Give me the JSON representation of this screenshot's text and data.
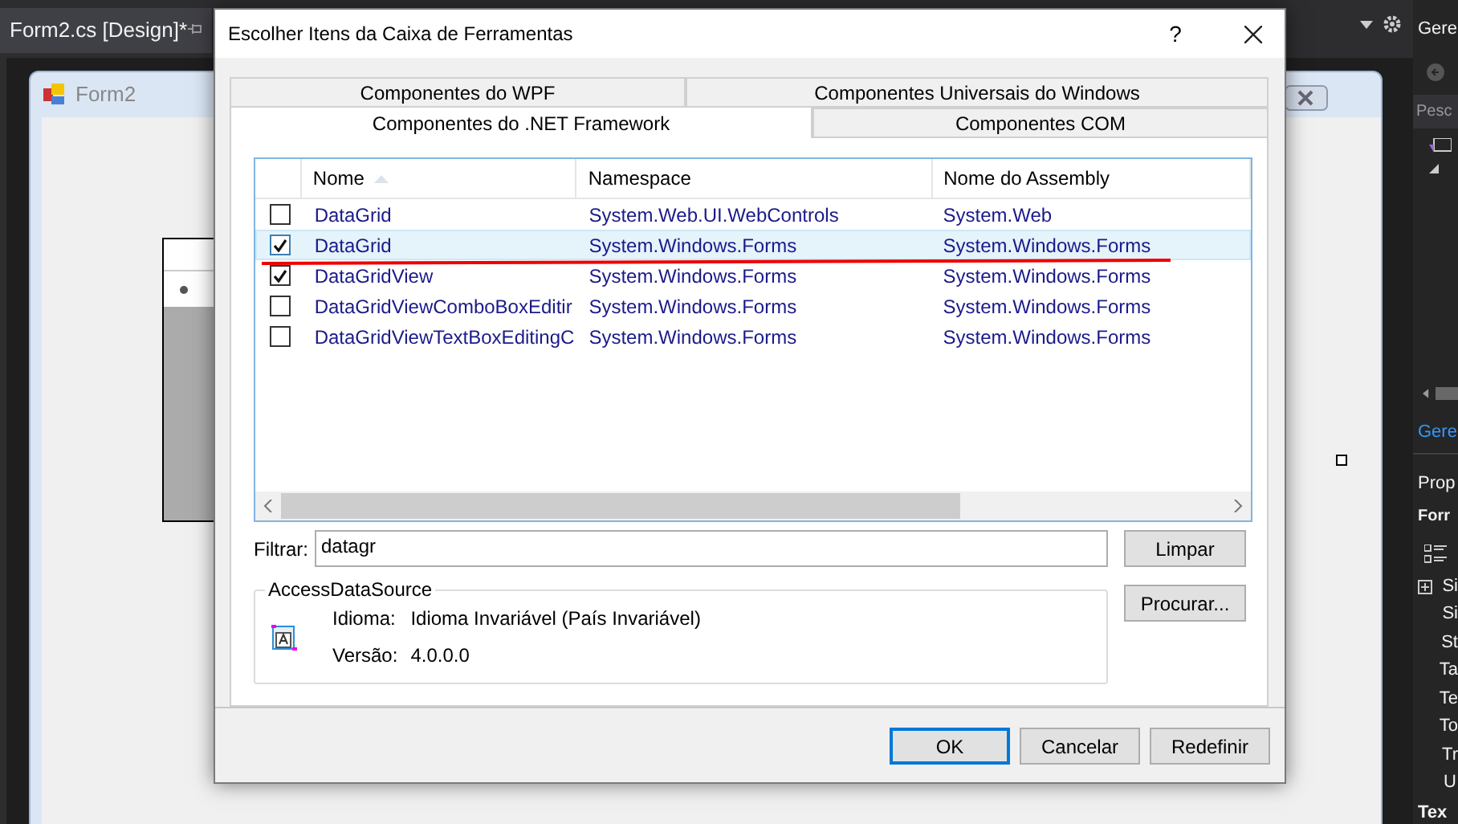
{
  "ide": {
    "document_tab": "Form2.cs [Design]*",
    "form_title": "Form2"
  },
  "side_panel": {
    "explorer_title": "Gere",
    "search_placeholder": "Pesc",
    "explorer_link": "Gere",
    "properties_title": "Prop",
    "object_name": "Forr",
    "properties": [
      {
        "name": "Si",
        "expandable": true
      },
      {
        "name": "Si",
        "expandable": false
      },
      {
        "name": "St",
        "expandable": false
      },
      {
        "name": "Ta",
        "expandable": false
      },
      {
        "name": "Te",
        "expandable": false
      },
      {
        "name": "To",
        "expandable": false
      },
      {
        "name": "Tr",
        "expandable": false
      },
      {
        "name": "U",
        "expandable": false
      }
    ],
    "description_title": "Tex"
  },
  "dialog": {
    "title": "Escolher Itens da Caixa de Ferramentas",
    "help": "?",
    "tab_rows": [
      [
        {
          "label": "Componentes do WPF",
          "selected": false
        },
        {
          "label": "Componentes Universais do Windows",
          "selected": false
        }
      ],
      [
        {
          "label": "Componentes do .NET Framework",
          "selected": true
        },
        {
          "label": "Componentes COM",
          "selected": false
        }
      ]
    ],
    "columns": [
      {
        "label": "Nome",
        "sorted": true
      },
      {
        "label": "Namespace",
        "sorted": false
      },
      {
        "label": "Nome do Assembly",
        "sorted": false
      }
    ],
    "rows": [
      {
        "checked": false,
        "selected": false,
        "name": "DataGrid",
        "namespace": "System.Web.UI.WebControls",
        "assembly": "System.Web"
      },
      {
        "checked": true,
        "selected": true,
        "name": "DataGrid",
        "namespace": "System.Windows.Forms",
        "assembly": "System.Windows.Forms"
      },
      {
        "checked": true,
        "selected": false,
        "name": "DataGridView",
        "namespace": "System.Windows.Forms",
        "assembly": "System.Windows.Forms"
      },
      {
        "checked": false,
        "selected": false,
        "name": "DataGridViewComboBoxEditir",
        "namespace": "System.Windows.Forms",
        "assembly": "System.Windows.Forms"
      },
      {
        "checked": false,
        "selected": false,
        "name": "DataGridViewTextBoxEditingC",
        "namespace": "System.Windows.Forms",
        "assembly": "System.Windows.Forms"
      }
    ],
    "filter": {
      "label": "Filtrar:",
      "value": "datagr"
    },
    "clear_button": "Limpar",
    "browse_button": "Procurar...",
    "details": {
      "title": "AccessDataSource",
      "fields": [
        {
          "label": "Idioma:",
          "value": "Idioma Invariável (País Invariável)"
        },
        {
          "label": "Versão:",
          "value": "4.0.0.0"
        }
      ]
    },
    "buttons": [
      {
        "label": "OK",
        "default": true
      },
      {
        "label": "Cancelar",
        "default": false
      },
      {
        "label": "Redefinir",
        "default": false
      }
    ]
  }
}
